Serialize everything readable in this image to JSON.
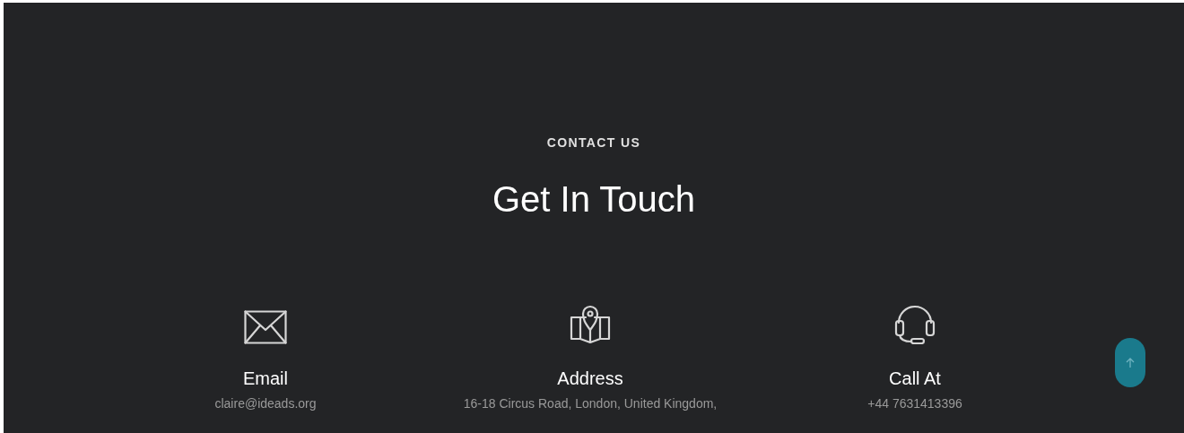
{
  "section": {
    "eyebrow": "CONTACT US",
    "title": "Get In Touch"
  },
  "contacts": [
    {
      "kind": "email",
      "label": "Email",
      "value": "claire@ideads.org"
    },
    {
      "kind": "address",
      "label": "Address",
      "value": "16-18 Circus Road, London, United Kingdom,"
    },
    {
      "kind": "phone",
      "label": "Call At",
      "value": "+44 7631413396"
    }
  ]
}
